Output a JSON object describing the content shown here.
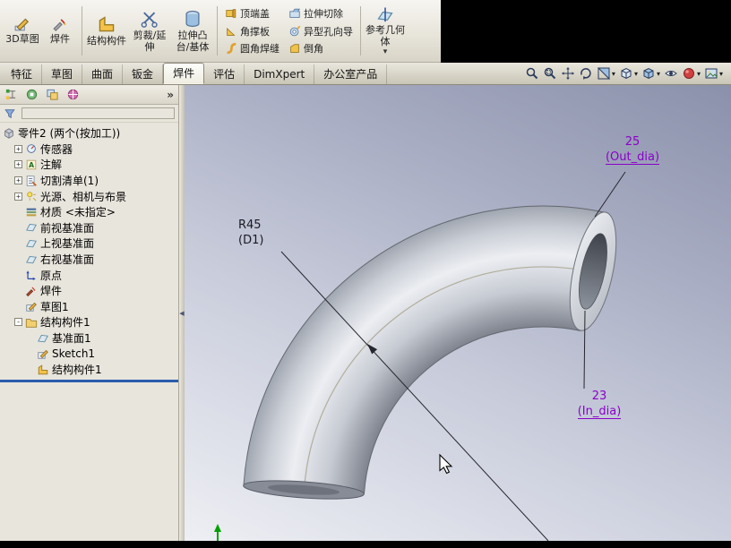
{
  "ribbon": {
    "sketch_group": [
      {
        "name": "3d-sketch-button",
        "label": "3D草图",
        "icon": "sketch3d-icon"
      },
      {
        "name": "weldment-button",
        "label": "焊件",
        "icon": "weldment-ribbon-icon"
      }
    ],
    "large_buttons": [
      {
        "name": "structural-member-button",
        "label": "结构构件",
        "icon": "structural-member-icon"
      },
      {
        "name": "trim-extend-button",
        "label": "剪裁/延伸",
        "icon": "trim-extend-icon"
      },
      {
        "name": "extruded-boss-base-button",
        "label": "拉伸凸台/基体",
        "icon": "extrude-boss-icon"
      }
    ],
    "stack_col1": [
      {
        "name": "end-cap-button",
        "label": "顶端盖",
        "icon": "end-cap-icon"
      },
      {
        "name": "gusset-button",
        "label": "角撑板",
        "icon": "gusset-icon"
      },
      {
        "name": "fillet-bead-button",
        "label": "圆角焊缝",
        "icon": "fillet-bead-icon"
      }
    ],
    "stack_col2": [
      {
        "name": "extruded-cut-button",
        "label": "拉伸切除",
        "icon": "extruded-cut-icon"
      },
      {
        "name": "hole-wizard-button",
        "label": "异型孔向导",
        "icon": "hole-wizard-icon"
      },
      {
        "name": "chamfer-button",
        "label": "倒角",
        "icon": "chamfer-icon"
      }
    ],
    "reference_button": {
      "name": "reference-geometry-button",
      "label": "参考几何体",
      "icon": "reference-geometry-icon",
      "has_dropdown": true
    }
  },
  "tab_bar": {
    "active_tab": "焊件",
    "tabs": [
      {
        "name": "tab-features",
        "label": "特征"
      },
      {
        "name": "tab-sketch",
        "label": "草图"
      },
      {
        "name": "tab-surfaces",
        "label": "曲面"
      },
      {
        "name": "tab-sheet-metal",
        "label": "钣金"
      },
      {
        "name": "tab-weldments",
        "label": "焊件"
      },
      {
        "name": "tab-evaluate",
        "label": "评估"
      },
      {
        "name": "tab-dimxpert",
        "label": "DimXpert"
      },
      {
        "name": "tab-office-products",
        "label": "办公室产品"
      }
    ],
    "view_tools": [
      {
        "name": "zoom-to-fit-button",
        "icon": "zoom-fit-icon",
        "dropdown": false
      },
      {
        "name": "zoom-to-area-button",
        "icon": "zoom-area-icon",
        "dropdown": false
      },
      {
        "name": "pan-button",
        "icon": "pan-icon",
        "dropdown": false
      },
      {
        "name": "rotate-view-button",
        "icon": "rotate-icon",
        "dropdown": false
      },
      {
        "name": "section-view-button",
        "icon": "section-icon",
        "dropdown": true
      },
      {
        "name": "view-orientation-button",
        "icon": "view-orientation-icon",
        "dropdown": true
      },
      {
        "name": "display-style-button",
        "icon": "display-style-icon",
        "dropdown": true
      },
      {
        "name": "hide-show-items-button",
        "icon": "hide-show-icon",
        "dropdown": false
      },
      {
        "name": "edit-appearance-button",
        "icon": "appearance-icon",
        "dropdown": true
      },
      {
        "name": "apply-scene-button",
        "icon": "scene-icon",
        "dropdown": true
      }
    ]
  },
  "panel": {
    "header_tabs": [
      {
        "name": "featuremanager-tree-tab",
        "icon": "fm-tree-icon"
      },
      {
        "name": "propertymanager-tab",
        "icon": "property-manager-icon"
      },
      {
        "name": "configurationmanager-tab",
        "icon": "configuration-icon"
      },
      {
        "name": "displaymanager-tab",
        "icon": "display-manager-icon"
      }
    ],
    "overflow_chevron": "»"
  },
  "feature_tree": {
    "root": {
      "name": "tree-item-part-root",
      "label": "零件2 (两个(按加工))",
      "icon": "part-icon",
      "level": 0
    },
    "items": [
      {
        "name": "tree-item-sensors",
        "label": "传感器",
        "icon": "sensors-icon",
        "expand": "plus",
        "level": 1
      },
      {
        "name": "tree-item-annotations",
        "label": "注解",
        "icon": "annotations-icon",
        "expand": "plus",
        "level": 1
      },
      {
        "name": "tree-item-cut-list",
        "label": "切割清单(1)",
        "icon": "cutlist-icon",
        "expand": "plus",
        "level": 1
      },
      {
        "name": "tree-item-lights-cameras",
        "label": "光源、相机与布景",
        "icon": "lights-icon",
        "expand": "plus",
        "level": 1
      },
      {
        "name": "tree-item-material",
        "label": "材质 <未指定>",
        "icon": "material-icon",
        "expand": "none",
        "level": 1
      },
      {
        "name": "tree-item-front-plane",
        "label": "前视基准面",
        "icon": "plane-icon",
        "expand": "none",
        "level": 1
      },
      {
        "name": "tree-item-top-plane",
        "label": "上视基准面",
        "icon": "plane-icon",
        "expand": "none",
        "level": 1
      },
      {
        "name": "tree-item-right-plane",
        "label": "右视基准面",
        "icon": "plane-icon",
        "expand": "none",
        "level": 1
      },
      {
        "name": "tree-item-origin",
        "label": "原点",
        "icon": "origin-icon",
        "expand": "none",
        "level": 1
      },
      {
        "name": "tree-item-weldment",
        "label": "焊件",
        "icon": "weldment-icon",
        "expand": "none",
        "level": 1
      },
      {
        "name": "tree-item-sketch1",
        "label": "草图1",
        "icon": "sketch-icon",
        "expand": "none",
        "level": 1
      },
      {
        "name": "tree-item-structural-member1",
        "label": "结构构件1",
        "icon": "folder-structural-icon",
        "expand": "minus",
        "level": 1
      },
      {
        "name": "tree-item-plane1",
        "label": "基准面1",
        "icon": "plane-icon",
        "expand": "none",
        "level": 2
      },
      {
        "name": "tree-item-sketch1-sub",
        "label": "Sketch1",
        "icon": "sketch-icon",
        "expand": "none",
        "level": 2
      },
      {
        "name": "tree-item-structural-member1-sub",
        "label": "结构构件1",
        "icon": "structural-member-icon",
        "expand": "none",
        "level": 2
      }
    ]
  },
  "viewport": {
    "annotations": {
      "radius_dim": {
        "line1": "R45",
        "line2": "(D1)"
      },
      "outer_dia_dim": {
        "line1": "25",
        "line2": "(Out_dia)"
      },
      "inner_dia_dim": {
        "line1": "23",
        "line2": "(In_dia)"
      }
    },
    "colors": {
      "dimension_purple": "#8b00c8",
      "radius_dim_color": "#1a1a24",
      "rollback_bar": "#2b5cad",
      "triad_green": "#00a000"
    }
  }
}
